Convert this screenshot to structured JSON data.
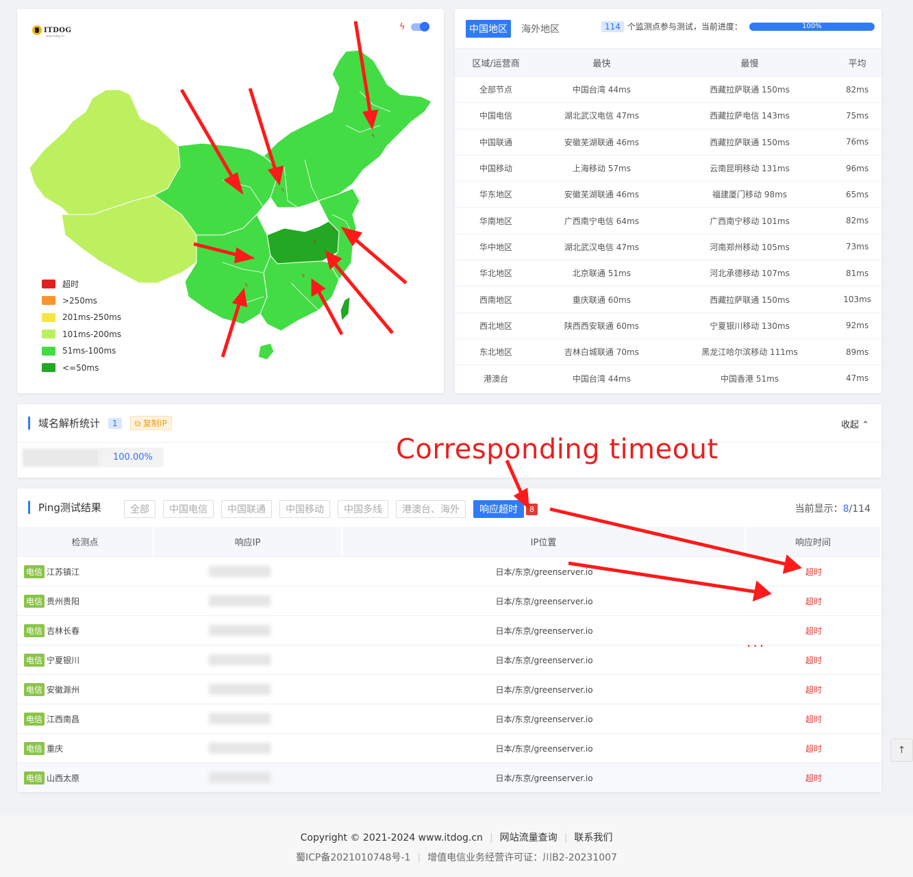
{
  "map": {
    "logo_text": "ITDOG",
    "logo_sub": "www.itdog.cn",
    "legend": [
      {
        "label": "超时",
        "color": "#e02020"
      },
      {
        "label": ">250ms",
        "color": "#f7952f"
      },
      {
        "label": "201ms-250ms",
        "color": "#f5e645"
      },
      {
        "label": "101ms-200ms",
        "color": "#bdf05f"
      },
      {
        "label": "51ms-100ms",
        "color": "#44dc44"
      },
      {
        "label": "<=50ms",
        "color": "#22a822"
      }
    ]
  },
  "stats": {
    "tabs": [
      {
        "label": "中国地区",
        "active": true
      },
      {
        "label": "海外地区",
        "active": false
      }
    ],
    "node_count": "114",
    "progress_label": "个监测点参与测试，当前进度：",
    "progress_value": 100,
    "progress_text": "100%",
    "headers": [
      "区域/运营商",
      "最快",
      "最慢",
      "平均"
    ],
    "rows": [
      [
        "全部节点",
        "中国台湾 44ms",
        "西藏拉萨联通 150ms",
        "82ms"
      ],
      [
        "中国电信",
        "湖北武汉电信 47ms",
        "西藏拉萨电信 143ms",
        "75ms"
      ],
      [
        "中国联通",
        "安徽芜湖联通 46ms",
        "西藏拉萨联通 150ms",
        "76ms"
      ],
      [
        "中国移动",
        "上海移动 57ms",
        "云南昆明移动 131ms",
        "96ms"
      ],
      [
        "华东地区",
        "安徽芜湖联通 46ms",
        "福建厦门移动 98ms",
        "65ms"
      ],
      [
        "华南地区",
        "广西南宁电信 64ms",
        "广西南宁移动 101ms",
        "82ms"
      ],
      [
        "华中地区",
        "湖北武汉电信 47ms",
        "河南郑州移动 105ms",
        "73ms"
      ],
      [
        "华北地区",
        "北京联通 51ms",
        "河北承德移动 107ms",
        "81ms"
      ],
      [
        "西南地区",
        "重庆联通 60ms",
        "西藏拉萨联通 150ms",
        "103ms"
      ],
      [
        "西北地区",
        "陕西西安联通 60ms",
        "宁夏银川移动 130ms",
        "92ms"
      ],
      [
        "东北地区",
        "吉林白城联通 70ms",
        "黑龙江哈尔滨移动 111ms",
        "89ms"
      ],
      [
        "港澳台",
        "中国台湾 44ms",
        "中国香港 51ms",
        "47ms"
      ]
    ]
  },
  "dns": {
    "title": "域名解析统计",
    "count": "1",
    "copy_label": "复制IP",
    "collapse_label": "收起",
    "percent": "100.00%"
  },
  "annotation": {
    "text": "Corresponding timeout",
    "ellipsis": "..."
  },
  "ping": {
    "title": "Ping测试结果",
    "filters": [
      {
        "label": "全部",
        "active": false
      },
      {
        "label": "中国电信",
        "active": false
      },
      {
        "label": "中国联通",
        "active": false
      },
      {
        "label": "中国移动",
        "active": false
      },
      {
        "label": "中国多线",
        "active": false
      },
      {
        "label": "港澳台、海外",
        "active": false
      },
      {
        "label": "响应超时",
        "active": true
      }
    ],
    "timeout_count": "8",
    "current_label": "当前显示：",
    "current_count": "8",
    "total": "/114",
    "headers": [
      "检测点",
      "响应IP",
      "IP位置",
      "响应时间"
    ],
    "rows": [
      {
        "isp": "电信",
        "city": "江苏镇江",
        "location": "日本/东京/greenserver.io",
        "time": "超时"
      },
      {
        "isp": "电信",
        "city": "贵州贵阳",
        "location": "日本/东京/greenserver.io",
        "time": "超时"
      },
      {
        "isp": "电信",
        "city": "吉林长春",
        "location": "日本/东京/greenserver.io",
        "time": "超时"
      },
      {
        "isp": "电信",
        "city": "宁夏银川",
        "location": "日本/东京/greenserver.io",
        "time": "超时"
      },
      {
        "isp": "电信",
        "city": "安徽滁州",
        "location": "日本/东京/greenserver.io",
        "time": "超时"
      },
      {
        "isp": "电信",
        "city": "江西南昌",
        "location": "日本/东京/greenserver.io",
        "time": "超时"
      },
      {
        "isp": "电信",
        "city": "重庆",
        "location": "日本/东京/greenserver.io",
        "time": "超时"
      },
      {
        "isp": "电信",
        "city": "山西太原",
        "location": "日本/东京/greenserver.io",
        "time": "超时"
      }
    ]
  },
  "footer": {
    "copyright": "Copyright © 2021-2024 www.itdog.cn",
    "link1": "网站流量查询",
    "link2": "联系我们",
    "icp": "蜀ICP备2021010748号-1",
    "license": "增值电信业务经营许可证：川B2-20231007"
  },
  "colors": {
    "accent": "#2f7bf5",
    "timeout_red": "#e53935",
    "annotation_red": "#ff1a1a"
  }
}
